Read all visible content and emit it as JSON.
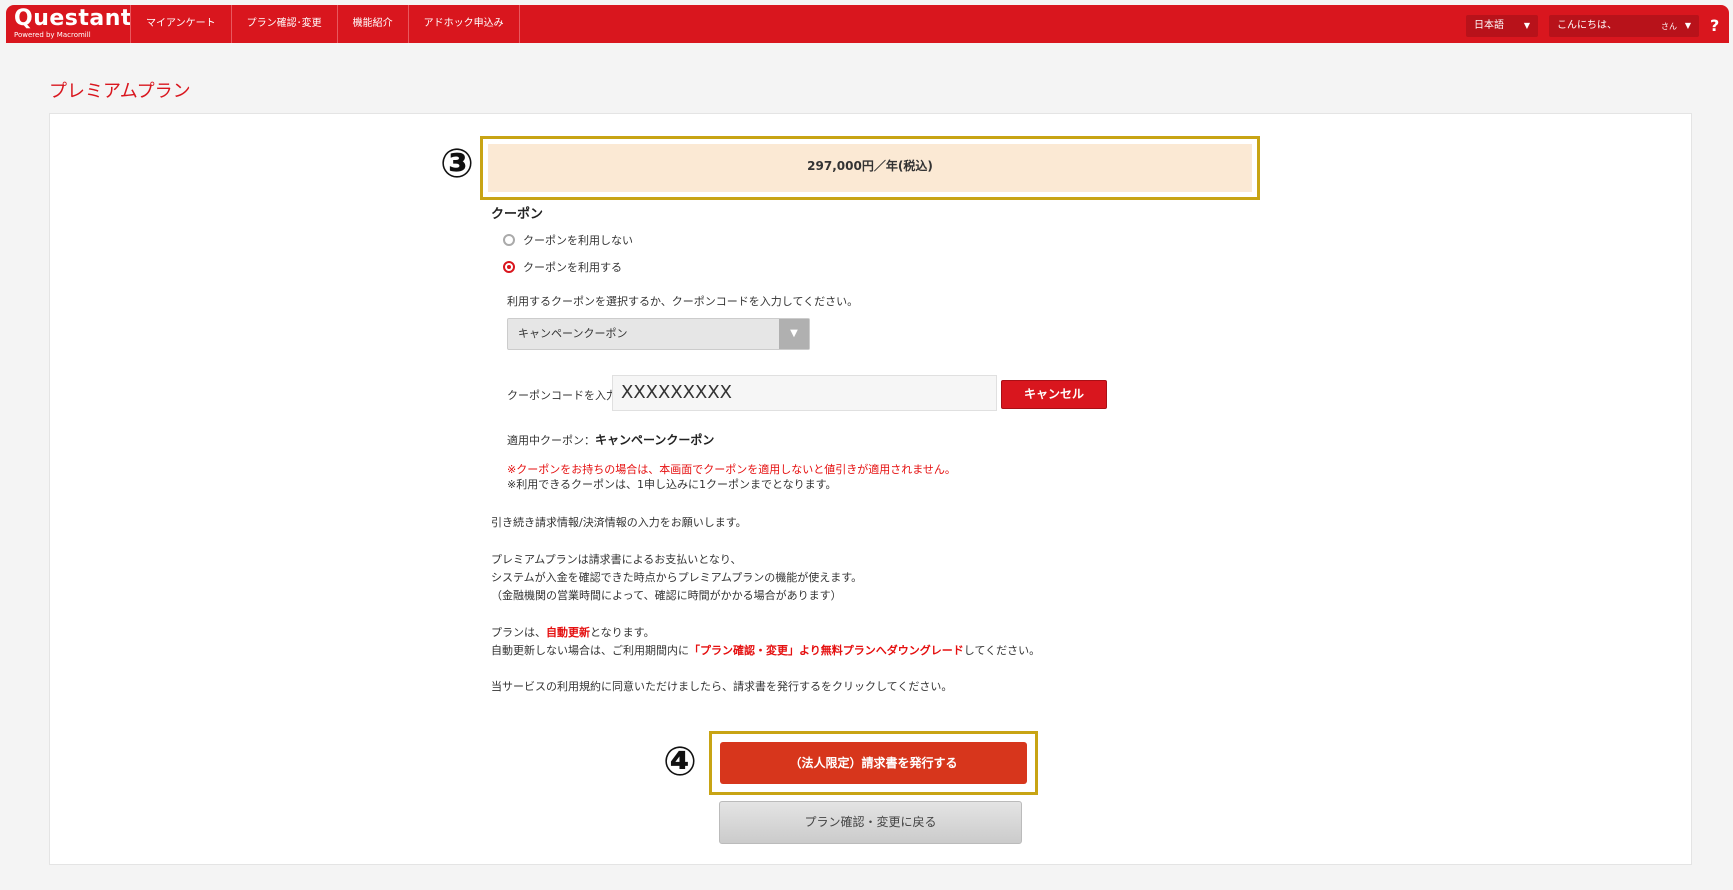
{
  "header": {
    "logo": "Questant",
    "logo_sub": "Powered by Macromill",
    "nav": [
      "マイアンケート",
      "プラン確認･変更",
      "機能紹介",
      "アドホック申込み"
    ],
    "language": "日本語",
    "greeting": "こんにちは、",
    "greeting_suffix": "さん",
    "help": "?"
  },
  "page": {
    "title": "プレミアムプラン"
  },
  "annotations": {
    "marker_3": "③",
    "marker_4": "④"
  },
  "price": {
    "text": "297,000円／年(税込)"
  },
  "coupon": {
    "section_label": "クーポン",
    "options": [
      "クーポンを利用しない",
      "クーポンを利用する"
    ],
    "selected_index": 1,
    "instruction": "利用するクーポンを選択するか、クーポンコードを入力してください。",
    "select_value": "キャンペーンクーポン",
    "code_label": "クーポンコードを入力",
    "code_value": "XXXXXXXXX",
    "cancel_label": "キャンセル",
    "applied_label": "適用中クーポン：",
    "applied_value": "キャンペーンクーポン",
    "warning": "※クーポンをお持ちの場合は、本画面でクーポンを適用しないと値引きが適用されません。",
    "note": "※利用できるクーポンは、1申し込みに1クーポンまでとなります。"
  },
  "info": {
    "line1": "引き続き請求情報/決済情報の入力をお願いします。",
    "line2": "プレミアムプランは請求書によるお支払いとなり、",
    "line3": "システムが入金を確認できた時点からプレミアムプランの機能が使えます。",
    "line4": "（金融機関の営業時間によって、確認に時間がかかる場合があります）",
    "renew_pre": "プランは、",
    "renew_bold": "自動更新",
    "renew_post": "となります。",
    "downgrade_pre": "自動更新しない場合は、ご利用期間内に",
    "downgrade_bold": "「プラン確認・変更」より無料プランへダウングレード",
    "downgrade_post": "してください。",
    "terms": "当サービスの利用規約に同意いただけましたら、請求書を発行するをクリックしてください。"
  },
  "buttons": {
    "issue": "（法人限定）請求書を発行する",
    "back": "プラン確認・変更に戻る"
  },
  "colors": {
    "brand": "#d9161e",
    "highlight_border": "#c8a414",
    "price_bg": "#fbe9d4"
  }
}
